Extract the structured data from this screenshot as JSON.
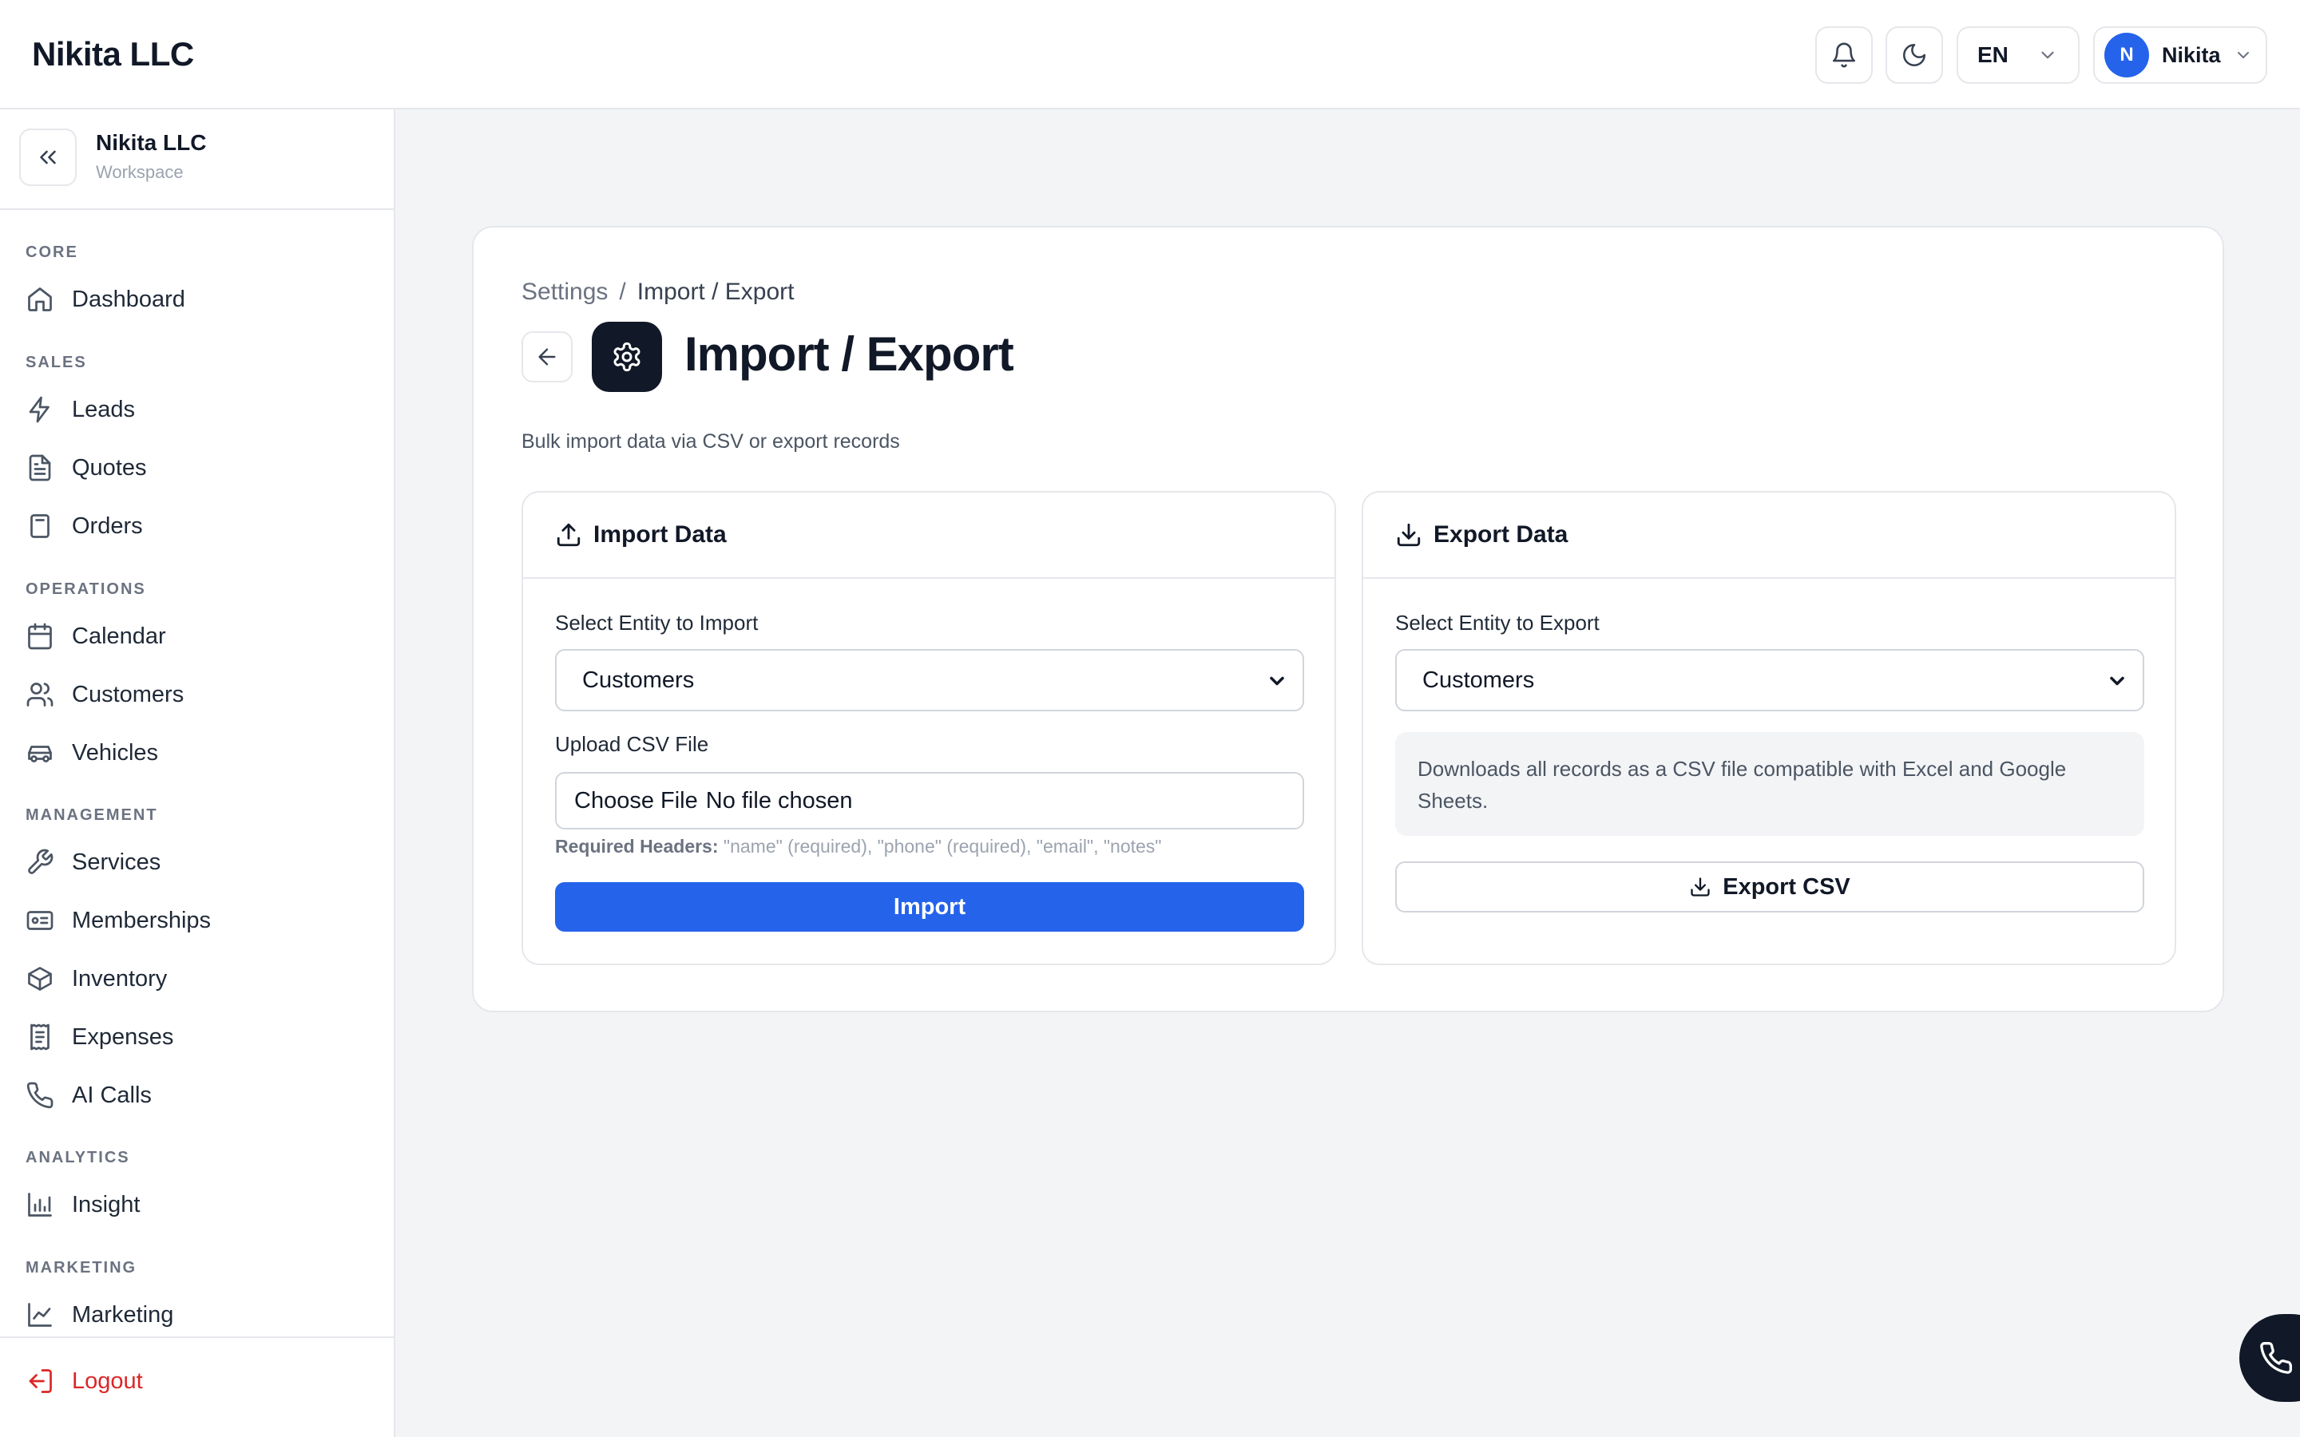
{
  "app": {
    "brand": "Nikita LLC"
  },
  "topbar": {
    "language": "EN",
    "user_initial": "N",
    "user_name": "Nikita"
  },
  "workspace": {
    "name": "Nikita LLC",
    "label": "Workspace"
  },
  "sidebar": {
    "sections": {
      "core": "CORE",
      "sales": "SALES",
      "operations": "OPERATIONS",
      "management": "MANAGEMENT",
      "analytics": "ANALYTICS",
      "marketing": "MARKETING"
    },
    "items": {
      "dashboard": "Dashboard",
      "leads": "Leads",
      "quotes": "Quotes",
      "orders": "Orders",
      "calendar": "Calendar",
      "customers": "Customers",
      "vehicles": "Vehicles",
      "services": "Services",
      "memberships": "Memberships",
      "inventory": "Inventory",
      "expenses": "Expenses",
      "ai_calls": "AI Calls",
      "insight": "Insight",
      "marketing": "Marketing"
    },
    "logout": "Logout"
  },
  "page": {
    "breadcrumb_parent": "Settings",
    "breadcrumb_sep": "/",
    "breadcrumb_current": "Import / Export",
    "title": "Import / Export",
    "subtitle": "Bulk import data via CSV or export records"
  },
  "import_panel": {
    "title": "Import Data",
    "entity_label": "Select Entity to Import",
    "entity_value": "Customers",
    "file_label": "Upload CSV File",
    "file_button": "Choose File",
    "file_status": "No file chosen",
    "hint_label": "Required Headers:",
    "hint_text": "\"name\" (required), \"phone\" (required), \"email\", \"notes\"",
    "submit": "Import"
  },
  "export_panel": {
    "title": "Export Data",
    "entity_label": "Select Entity to Export",
    "entity_value": "Customers",
    "info": "Downloads all records as a CSV file compatible with Excel and Google Sheets.",
    "button": "Export CSV"
  },
  "colors": {
    "primary": "#2563eb",
    "dark": "#111827",
    "danger": "#dc2626",
    "background": "#f3f4f6"
  }
}
